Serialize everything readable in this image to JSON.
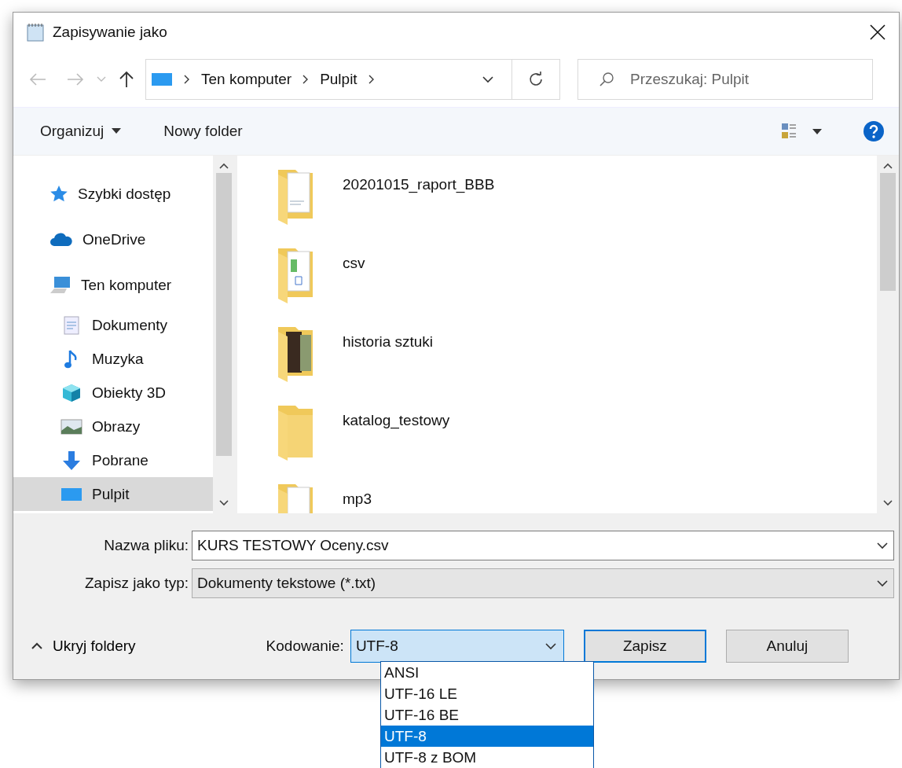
{
  "window": {
    "title": "Zapisywanie jako"
  },
  "nav": {
    "breadcrumb": [
      "Ten komputer",
      "Pulpit"
    ],
    "search_placeholder": "Przeszukaj: Pulpit"
  },
  "toolbar": {
    "organize": "Organizuj",
    "new_folder": "Nowy folder"
  },
  "sidebar": {
    "items": [
      {
        "label": "Szybki dostęp",
        "selected": false
      },
      {
        "label": "OneDrive",
        "selected": false
      },
      {
        "label": "Ten komputer",
        "selected": false,
        "children": [
          {
            "label": "Dokumenty",
            "selected": false
          },
          {
            "label": "Muzyka",
            "selected": false
          },
          {
            "label": "Obiekty 3D",
            "selected": false
          },
          {
            "label": "Obrazy",
            "selected": false
          },
          {
            "label": "Pobrane",
            "selected": false
          },
          {
            "label": "Pulpit",
            "selected": true
          }
        ]
      }
    ]
  },
  "files": [
    {
      "name": "20201015_raport_BBB"
    },
    {
      "name": "csv"
    },
    {
      "name": "historia sztuki"
    },
    {
      "name": "katalog_testowy"
    },
    {
      "name": "mp3"
    }
  ],
  "file_name": {
    "label": "Nazwa pliku:",
    "value": "KURS TESTOWY Oceny.csv"
  },
  "file_type": {
    "label": "Zapisz jako typ:",
    "value": "Dokumenty tekstowe (*.txt)"
  },
  "hide_folders": "Ukryj foldery",
  "encoding": {
    "label": "Kodowanie:",
    "value": "UTF-8",
    "options": [
      {
        "label": "ANSI",
        "selected": false
      },
      {
        "label": "UTF-16 LE",
        "selected": false
      },
      {
        "label": "UTF-16 BE",
        "selected": false
      },
      {
        "label": "UTF-8",
        "selected": true
      },
      {
        "label": "UTF-8 z BOM",
        "selected": false
      }
    ]
  },
  "buttons": [
    {
      "label": "Zapisz",
      "kind": "default"
    },
    {
      "label": "Anuluj",
      "kind": "normal"
    }
  ]
}
